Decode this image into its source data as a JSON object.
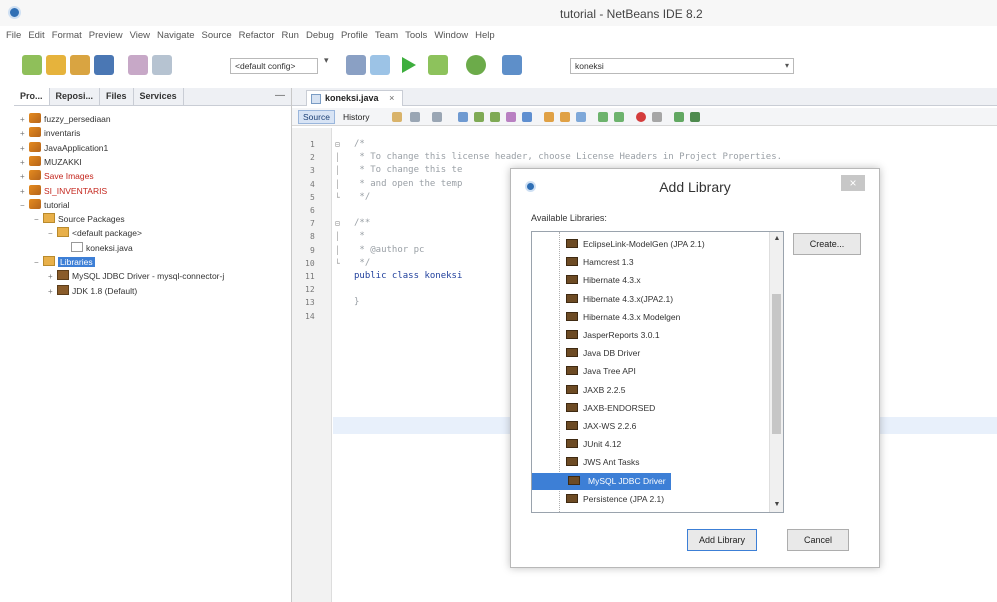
{
  "window": {
    "title": "tutorial - NetBeans IDE 8.2"
  },
  "menu": [
    "File",
    "Edit",
    "Format",
    "Preview",
    "View",
    "Navigate",
    "Source",
    "Refactor",
    "Run",
    "Debug",
    "Profile",
    "Team",
    "Tools",
    "Window",
    "Help"
  ],
  "toolbar": {
    "config": "<default config>",
    "search": "koneksi"
  },
  "explorer": {
    "tabs": [
      "Pro...",
      "Reposi...",
      "Files",
      "Services"
    ],
    "minimize": "—",
    "tree": [
      {
        "label": "fuzzy_persediaan",
        "toggle": "+",
        "icon": "project",
        "level": 0,
        "style": "normal"
      },
      {
        "label": "inventaris",
        "toggle": "+",
        "icon": "project",
        "level": 0,
        "style": "normal"
      },
      {
        "label": "JavaApplication1",
        "toggle": "+",
        "icon": "project",
        "level": 0,
        "style": "normal"
      },
      {
        "label": "MUZAKKI",
        "toggle": "+",
        "icon": "project",
        "level": 0,
        "style": "normal"
      },
      {
        "label": "Save Images",
        "toggle": "+",
        "icon": "project",
        "level": 0,
        "style": "red"
      },
      {
        "label": "SI_INVENTARIS",
        "toggle": "+",
        "icon": "project",
        "level": 0,
        "style": "red"
      },
      {
        "label": "tutorial",
        "toggle": "−",
        "icon": "project",
        "level": 0,
        "style": "normal"
      },
      {
        "label": "Source Packages",
        "toggle": "−",
        "icon": "package",
        "level": 1,
        "style": "normal"
      },
      {
        "label": "<default package>",
        "toggle": "−",
        "icon": "package",
        "level": 2,
        "style": "normal"
      },
      {
        "label": "koneksi.java",
        "toggle": "",
        "icon": "java",
        "level": 3,
        "style": "normal"
      },
      {
        "label": "Libraries",
        "toggle": "−",
        "icon": "package",
        "level": 1,
        "style": "selected"
      },
      {
        "label": "MySQL JDBC Driver - mysql-connector-j",
        "toggle": "+",
        "icon": "library",
        "level": 2,
        "style": "normal"
      },
      {
        "label": "JDK 1.8 (Default)",
        "toggle": "+",
        "icon": "library",
        "level": 2,
        "style": "normal"
      }
    ]
  },
  "editor": {
    "tab": "koneksi.java",
    "tab_close": "×",
    "modes": [
      "Source",
      "History"
    ],
    "line_numbers": [
      "1",
      "2",
      "3",
      "4",
      "5",
      "6",
      "7",
      "8",
      "9",
      "10",
      "11",
      "12",
      "13",
      "14"
    ],
    "lines": [
      {
        "text": "/*",
        "kind": "comment"
      },
      {
        "text": " * To change this license header, choose License Headers in Project Properties.",
        "kind": "comment"
      },
      {
        "text": " * To change this te",
        "kind": "comment"
      },
      {
        "text": " * and open the temp",
        "kind": "comment"
      },
      {
        "text": " */",
        "kind": "comment"
      },
      {
        "text": "",
        "kind": "comment"
      },
      {
        "text": "/**",
        "kind": "comment"
      },
      {
        "text": " *",
        "kind": "comment"
      },
      {
        "text": " * @author pc",
        "kind": "comment"
      },
      {
        "text": " */",
        "kind": "comment"
      },
      {
        "text": "public class koneksi",
        "kind": "code"
      },
      {
        "text": "",
        "kind": "code"
      },
      {
        "text": "}",
        "kind": "comment"
      },
      {
        "text": "",
        "kind": "comment"
      }
    ]
  },
  "dialog": {
    "title": "Add Library",
    "close": "×",
    "available_label": "Available Libraries:",
    "libraries": [
      "EclipseLink-ModelGen (JPA 2.1)",
      "Hamcrest 1.3",
      "Hibernate 4.3.x",
      "Hibernate 4.3.x(JPA2.1)",
      "Hibernate 4.3.x Modelgen",
      "JasperReports 3.0.1",
      "Java DB Driver",
      "Java Tree API",
      "JAXB 2.2.5",
      "JAXB-ENDORSED",
      "JAX-WS 2.2.6",
      "JUnit 4.12",
      "JWS Ant Tasks",
      "MySQL JDBC Driver",
      "Persistence (JPA 2.1)"
    ],
    "selected_library": "MySQL JDBC Driver",
    "create_button": "Create...",
    "add_button": "Add Library",
    "cancel_button": "Cancel"
  }
}
